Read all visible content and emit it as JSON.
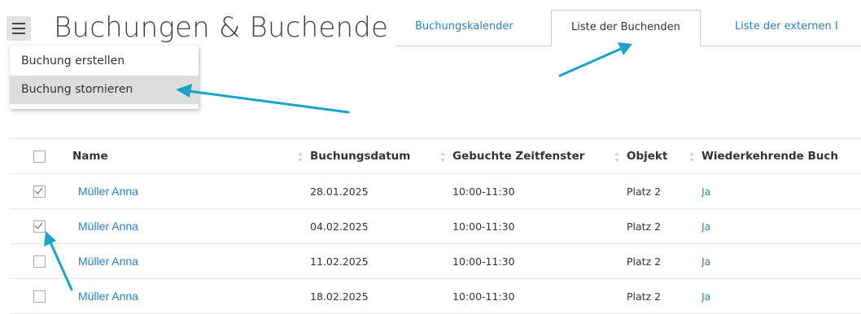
{
  "header": {
    "title": "Buchungen & Buchende",
    "menu_icon": "hamburger-menu-icon"
  },
  "dropdown": {
    "items": [
      {
        "label": "Buchung erstellen",
        "highlighted": false
      },
      {
        "label": "Buchung stornieren",
        "highlighted": true
      }
    ]
  },
  "tabs": [
    {
      "label": "Buchungskalender",
      "active": false
    },
    {
      "label": "Liste der Buchenden",
      "active": true
    },
    {
      "label": "Liste der externen I",
      "active": false
    }
  ],
  "table": {
    "columns": [
      {
        "label": "Name",
        "sortable": true
      },
      {
        "label": "Buchungsdatum",
        "sortable": true
      },
      {
        "label": "Gebuchte Zeitfenster",
        "sortable": true
      },
      {
        "label": "Objekt",
        "sortable": true
      },
      {
        "label": "Wiederkehrende Buch",
        "sortable": false
      }
    ],
    "rows": [
      {
        "checked": true,
        "name": "Müller Anna",
        "date": "28.01.2025",
        "slot": "10:00-11:30",
        "object": "Platz 2",
        "recurring": "Ja"
      },
      {
        "checked": true,
        "name": "Müller Anna",
        "date": "04.02.2025",
        "slot": "10:00-11:30",
        "object": "Platz 2",
        "recurring": "Ja"
      },
      {
        "checked": false,
        "name": "Müller Anna",
        "date": "11.02.2025",
        "slot": "10:00-11:30",
        "object": "Platz 2",
        "recurring": "Ja"
      },
      {
        "checked": false,
        "name": "Müller Anna",
        "date": "18.02.2025",
        "slot": "10:00-11:30",
        "object": "Platz 2",
        "recurring": "Ja"
      }
    ]
  },
  "colors": {
    "link": "#2a7fc0",
    "annotation_arrow": "#1aa3c8",
    "highlight": "#dddddd"
  }
}
